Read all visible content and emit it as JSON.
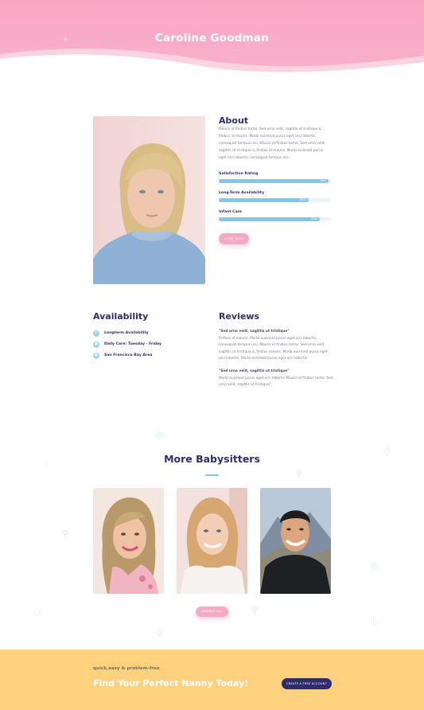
{
  "hero": {
    "title": "Caroline Goodman"
  },
  "about": {
    "title": "About",
    "text": "Mauris id finibus tortor. Sed urna velit, sagittis ut tristique a, finibus id mauris. Morbi euismod purus eget orci lobortis, consequat tempus nisi. Mauris id finibus tortor. Sed urna velit, sagittis ut tristique a, finibus id mauris. Morbi euismod purus eget orci lobortis, consequat tempus nisi.",
    "skills": [
      {
        "label": "Satisfaction Rating",
        "value": 98,
        "pct_label": "98%"
      },
      {
        "label": "Long-Term Availability",
        "value": 80,
        "pct_label": "80%"
      },
      {
        "label": "Infant Care",
        "value": 90,
        "pct_label": "90%"
      }
    ],
    "book_label": "BOOK NOW"
  },
  "availability": {
    "title": "Availability",
    "items": [
      {
        "icon": "clock-icon",
        "text": "Longterm Availability"
      },
      {
        "icon": "calendar-icon",
        "text": "Daily Care: Tuesday - Friday"
      },
      {
        "icon": "location-icon",
        "text": "San Francisco Bay Area"
      }
    ]
  },
  "reviews": {
    "title": "Reviews",
    "items": [
      {
        "quote": "\"Sed urna velit, sagittis ut tristique\"",
        "text": "Finibus id mauris. Morbi euismod purus eget orci lobortis, consequat tempus nisi. Mauris id finibus tortor. Sed urna velit, sagittis ut tristique a, finibus mauris. Morbi euismod purus eget orci lobortis. Morbi euismod purus eget orci lobortis\""
      },
      {
        "quote": "\"Sed urna velit, sagittis ut tristique\"",
        "text": "Morbi euismod purus eget orci lobortis Mauris id finibus tortor. Sed urna velit, sagittis ut tristique\""
      }
    ]
  },
  "more": {
    "title": "More Babysitters",
    "browse_label": "BROWSE ALL"
  },
  "cta": {
    "subtitle": "quick,easy & problem-free",
    "title": "Find Your Perfect Nanny Today!",
    "button_label": "CREATE A FREE ACCOUNT"
  },
  "colors": {
    "pink": "#f7a9c3",
    "navy": "#2f2d6b",
    "blue": "#7ec9ea",
    "yellow": "#fdd17d"
  }
}
